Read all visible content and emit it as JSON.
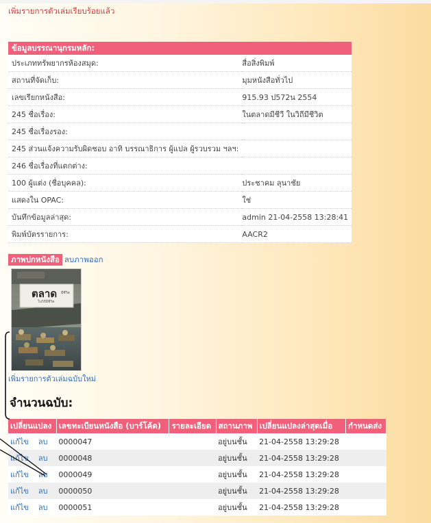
{
  "success_message": "เพิ่มรายการตัวเล่มเรียบร้อยแล้ว",
  "info": {
    "header": "ข้อมูลบรรณานุกรมหลัก:",
    "rows": [
      {
        "label": "ประเภททรัพยากรห้องสมุด:",
        "value": "สื่อสิ่งพิมพ์",
        "link": false
      },
      {
        "label": "สถานที่จัดเก็บ:",
        "value": "มุมหนังสือทั่วไป",
        "link": false
      },
      {
        "label": "เลขเรียกหนังสือ:",
        "value": "915.93 ป572น 2554",
        "link": false
      },
      {
        "label": "245 ชื่อเรื่อง:",
        "value": "ในตลาดมีชีวี ในวิถีมีชีวิต",
        "link": false
      },
      {
        "label": "245 ชื่อเรื่องรอง:",
        "value": "",
        "link": false
      },
      {
        "label": "245 ส่วนแจ้งความรับผิดชอบ อาทิ บรรณาธิการ ผู้แปล ผู้รวบรวม ฯลฯ:",
        "value": "",
        "link": false
      },
      {
        "label": "246 ชื่อเรื่องที่แตกต่าง:",
        "value": "",
        "link": false
      },
      {
        "label": "100 ผู้แต่ง (ชื่อบุคคล):",
        "value": "ประชาคม ลุนาชัย",
        "link": true
      },
      {
        "label": "แสดงใน OPAC:",
        "value": "ใช่",
        "link": false
      },
      {
        "label": "บันทึกข้อมูลล่าสุด:",
        "value": "admin 21-04-2558 13:28:41",
        "link": false
      },
      {
        "label": "พิมพ์บัตรรายการ:",
        "value": "AACR2",
        "link": true
      }
    ]
  },
  "cover": {
    "title": "ภาพปกหนังสือ",
    "remove_label": "ลบภาพออก",
    "book_title_main": "ตลาด",
    "book_title_small": "มีชีวิต",
    "book_subtitle": "ในวิถีมีชีวิต"
  },
  "add_copy_link": "เพิ่มรายการตัวเล่มฉบับใหม่",
  "copies": {
    "title": "จำนวนฉบับ:",
    "columns": [
      "เปลี่ยนแปลง",
      "เลขทะเบียนหนังสือ (บาร์โค้ด)",
      "รายละเอียด",
      "สถานภาพ",
      "เปลี่ยนแปลงล่าสุดเมื่อ",
      "กำหนดส่ง"
    ],
    "rows": [
      {
        "edit": "แก้ไข",
        "delete": "ลบ",
        "barcode": "0000047",
        "detail": "",
        "status": "อยู่บนชั้น",
        "modified": "21-04-2558 13:29:28",
        "due": ""
      },
      {
        "edit": "แก้ไข",
        "delete": "ลบ",
        "barcode": "0000048",
        "detail": "",
        "status": "อยู่บนชั้น",
        "modified": "21-04-2558 13:29:28",
        "due": ""
      },
      {
        "edit": "แก้ไข",
        "delete": "ลบ",
        "barcode": "0000049",
        "detail": "",
        "status": "อยู่บนชั้น",
        "modified": "21-04-2558 13:29:28",
        "due": ""
      },
      {
        "edit": "แก้ไข",
        "delete": "ลบ",
        "barcode": "0000050",
        "detail": "",
        "status": "อยู่บนชั้น",
        "modified": "21-04-2558 13:29:28",
        "due": ""
      },
      {
        "edit": "แก้ไข",
        "delete": "ลบ",
        "barcode": "0000051",
        "detail": "",
        "status": "อยู่บนชั้น",
        "modified": "21-04-2558 13:29:28",
        "due": ""
      }
    ]
  },
  "colors": {
    "accent": "#f0607a",
    "link": "#2e6fc0",
    "success": "#d33a3a"
  }
}
